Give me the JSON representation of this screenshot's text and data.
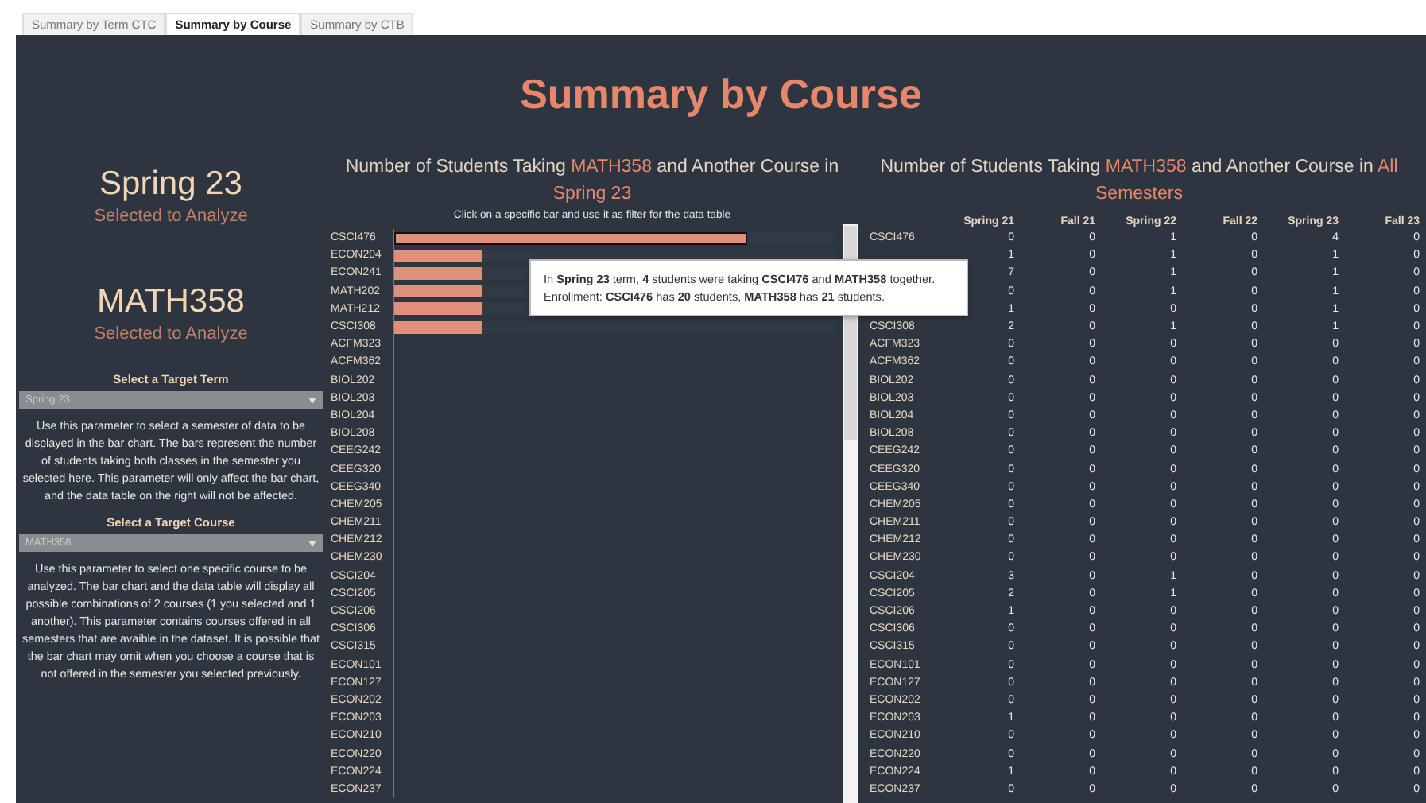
{
  "tabs": [
    {
      "label": "Summary by Term CTC",
      "selected": false
    },
    {
      "label": "Summary by Course",
      "selected": true
    },
    {
      "label": "Summary by CTB",
      "selected": false
    }
  ],
  "page_title": "Summary by Course",
  "selection": {
    "term": "Spring 23",
    "term_caption": "Selected to Analyze",
    "course": "MATH358",
    "course_caption": "Selected to Analyze"
  },
  "term_parameter": {
    "label": "Select a Target Term",
    "value": "Spring 23",
    "help": "Use this parameter to select a semester of data to be displayed in the bar chart. The bars represent the number of students taking both classes in the semester you selected here. This parameter will only affect the bar chart, and the data table on the right will not be affected."
  },
  "course_parameter": {
    "label": "Select a Target Course",
    "value": "MATH358",
    "help": "Use this parameter to select one specific course to be analyzed. The bar chart and the data table will display all possible combinations of 2 courses (1 you selected and 1 another). This parameter contains courses offered in all semesters that are avaible in the dataset. It is possible that the bar chart may omit when you choose a course that is not offered in the semester you selected previously."
  },
  "bar_chart": {
    "title_parts": [
      {
        "text": "Number of Students Taking ",
        "highlight": false
      },
      {
        "text": "MATH358",
        "highlight": true
      },
      {
        "text": " and Another Course in ",
        "highlight": false
      },
      {
        "text": "Spring 23",
        "highlight": true
      }
    ],
    "subtitle": "Click on a specific bar and use it as filter for the data table",
    "bars": [
      {
        "label": "CSCI476",
        "level": 0.8,
        "selected": true
      },
      {
        "label": "ECON204",
        "level": 0.2,
        "selected": false
      },
      {
        "label": "ECON241",
        "level": 0.2,
        "selected": false
      },
      {
        "label": "MATH202",
        "level": 0.2,
        "selected": false
      },
      {
        "label": "MATH212",
        "level": 0.2,
        "selected": false
      },
      {
        "label": "CSCI308",
        "level": 0.2,
        "selected": false
      },
      {
        "label": "ACFM323",
        "selected": false
      },
      {
        "label": "ACFM362",
        "selected": false
      },
      {
        "label": "BIOL202",
        "selected": false
      },
      {
        "label": "BIOL203",
        "selected": false
      },
      {
        "label": "BIOL204",
        "selected": false
      },
      {
        "label": "BIOL208",
        "selected": false
      },
      {
        "label": "CEEG242",
        "selected": false
      },
      {
        "label": "CEEG320",
        "selected": false
      },
      {
        "label": "CEEG340",
        "selected": false
      },
      {
        "label": "CHEM205",
        "selected": false
      },
      {
        "label": "CHEM211",
        "selected": false
      },
      {
        "label": "CHEM212",
        "selected": false
      },
      {
        "label": "CHEM230",
        "selected": false
      },
      {
        "label": "CSCI204",
        "selected": false
      },
      {
        "label": "CSCI205",
        "selected": false
      },
      {
        "label": "CSCI206",
        "selected": false
      },
      {
        "label": "CSCI306",
        "selected": false
      },
      {
        "label": "CSCI315",
        "selected": false
      },
      {
        "label": "ECON101",
        "selected": false
      },
      {
        "label": "ECON127",
        "selected": false
      },
      {
        "label": "ECON202",
        "selected": false
      },
      {
        "label": "ECON203",
        "selected": false
      },
      {
        "label": "ECON210",
        "selected": false
      },
      {
        "label": "ECON220",
        "selected": false
      },
      {
        "label": "ECON224",
        "selected": false
      },
      {
        "label": "ECON237",
        "selected": false
      }
    ]
  },
  "tooltip": {
    "lines": [
      "In **Spring 23** term, **4** students were taking **CSCI476** and **MATH358** together.",
      "Enrollment: **CSCI476** has **20** students, **MATH358** has **21** students."
    ]
  },
  "table": {
    "title_parts": [
      {
        "text": "Number of Students Taking ",
        "highlight": false
      },
      {
        "text": "MATH358",
        "highlight": true
      },
      {
        "text": " and Another Course in ",
        "highlight": false
      },
      {
        "text": "All Semesters",
        "highlight": true
      }
    ],
    "columns": [
      "Spring 21",
      "Fall 21",
      "Spring 22",
      "Fall 22",
      "Spring 23",
      "Fall 23"
    ],
    "rows": [
      {
        "label": "CSCI476",
        "values": [
          "0",
          "0",
          "1",
          "0",
          "4",
          "0"
        ]
      },
      {
        "values": [
          "1",
          "0",
          "1",
          "0",
          "1",
          "0"
        ]
      },
      {
        "values": [
          "7",
          "0",
          "1",
          "0",
          "1",
          "0"
        ]
      },
      {
        "values": [
          "0",
          "0",
          "1",
          "0",
          "1",
          "0"
        ]
      },
      {
        "values": [
          "1",
          "0",
          "0",
          "0",
          "1",
          "0"
        ]
      },
      {
        "label": "CSCI308",
        "values": [
          "2",
          "0",
          "1",
          "0",
          "1",
          "0"
        ]
      },
      {
        "label": "ACFM323",
        "values": [
          "0",
          "0",
          "0",
          "0",
          "0",
          "0"
        ]
      },
      {
        "label": "ACFM362",
        "values": [
          "0",
          "0",
          "0",
          "0",
          "0",
          "0"
        ]
      },
      {
        "label": "BIOL202",
        "values": [
          "0",
          "0",
          "0",
          "0",
          "0",
          "0"
        ]
      },
      {
        "label": "BIOL203",
        "values": [
          "0",
          "0",
          "0",
          "0",
          "0",
          "0"
        ]
      },
      {
        "label": "BIOL204",
        "values": [
          "0",
          "0",
          "0",
          "0",
          "0",
          "0"
        ]
      },
      {
        "label": "BIOL208",
        "values": [
          "0",
          "0",
          "0",
          "0",
          "0",
          "0"
        ]
      },
      {
        "label": "CEEG242",
        "values": [
          "0",
          "0",
          "0",
          "0",
          "0",
          "0"
        ]
      },
      {
        "label": "CEEG320",
        "values": [
          "0",
          "0",
          "0",
          "0",
          "0",
          "0"
        ]
      },
      {
        "label": "CEEG340",
        "values": [
          "0",
          "0",
          "0",
          "0",
          "0",
          "0"
        ]
      },
      {
        "label": "CHEM205",
        "values": [
          "0",
          "0",
          "0",
          "0",
          "0",
          "0"
        ]
      },
      {
        "label": "CHEM211",
        "values": [
          "0",
          "0",
          "0",
          "0",
          "0",
          "0"
        ]
      },
      {
        "label": "CHEM212",
        "values": [
          "0",
          "0",
          "0",
          "0",
          "0",
          "0"
        ]
      },
      {
        "label": "CHEM230",
        "values": [
          "0",
          "0",
          "0",
          "0",
          "0",
          "0"
        ]
      },
      {
        "label": "CSCI204",
        "values": [
          "3",
          "0",
          "1",
          "0",
          "0",
          "0"
        ]
      },
      {
        "label": "CSCI205",
        "values": [
          "2",
          "0",
          "1",
          "0",
          "0",
          "0"
        ]
      },
      {
        "label": "CSCI206",
        "values": [
          "1",
          "0",
          "0",
          "0",
          "0",
          "0"
        ]
      },
      {
        "label": "CSCI306",
        "values": [
          "0",
          "0",
          "0",
          "0",
          "0",
          "0"
        ]
      },
      {
        "label": "CSCI315",
        "values": [
          "0",
          "0",
          "0",
          "0",
          "0",
          "0"
        ]
      },
      {
        "label": "ECON101",
        "values": [
          "0",
          "0",
          "0",
          "0",
          "0",
          "0"
        ]
      },
      {
        "label": "ECON127",
        "values": [
          "0",
          "0",
          "0",
          "0",
          "0",
          "0"
        ]
      },
      {
        "label": "ECON202",
        "values": [
          "0",
          "0",
          "0",
          "0",
          "0",
          "0"
        ]
      },
      {
        "label": "ECON203",
        "values": [
          "1",
          "0",
          "0",
          "0",
          "0",
          "0"
        ]
      },
      {
        "label": "ECON210",
        "values": [
          "0",
          "0",
          "0",
          "0",
          "0",
          "0"
        ]
      },
      {
        "label": "ECON220",
        "values": [
          "0",
          "0",
          "0",
          "0",
          "0",
          "0"
        ]
      },
      {
        "label": "ECON224",
        "values": [
          "1",
          "0",
          "0",
          "0",
          "0",
          "0"
        ]
      },
      {
        "label": "ECON237",
        "values": [
          "0",
          "0",
          "0",
          "0",
          "0",
          "0"
        ]
      }
    ]
  }
}
